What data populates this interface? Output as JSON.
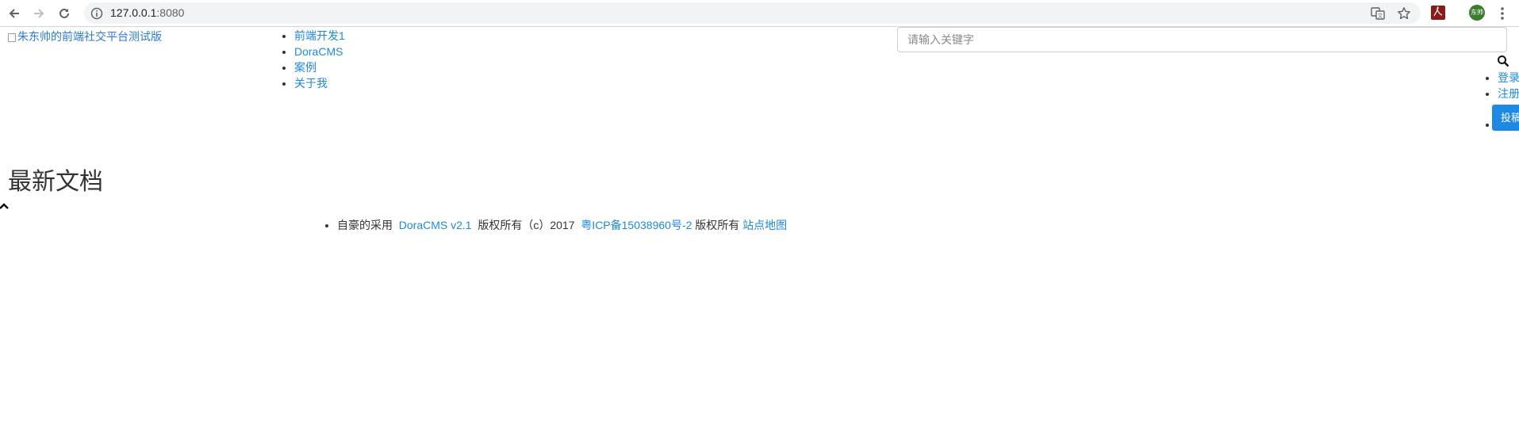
{
  "browser": {
    "url_host": "127.0.0.1",
    "url_port": ":8080",
    "profile_initials": "东帅",
    "icons": [
      "back-arrow-icon",
      "forward-arrow-icon",
      "reload-icon",
      "info-icon",
      "translate-icon",
      "star-icon",
      "pdf-extension-icon",
      "menu-dots-icon"
    ]
  },
  "header": {
    "logo_alt": "朱东帅的前端社交平台测试版",
    "nav": [
      "前端开发1",
      "DoraCMS",
      "案例",
      "关于我"
    ],
    "search_placeholder": "请输入关键字",
    "user_links": [
      "登录",
      "注册"
    ],
    "post_button": "投稿"
  },
  "main": {
    "title": "最新文档"
  },
  "footer": {
    "powered_prefix": "自豪的采用",
    "cms_link": "DoraCMS v2.1",
    "copyright": "版权所有（c）2017",
    "icp_link": "粤ICP备15038960号-2",
    "rights": "版权所有",
    "sitemap_link": "站点地图"
  },
  "colors": {
    "link": "#1e88e5",
    "button_bg": "#1e88e5"
  }
}
